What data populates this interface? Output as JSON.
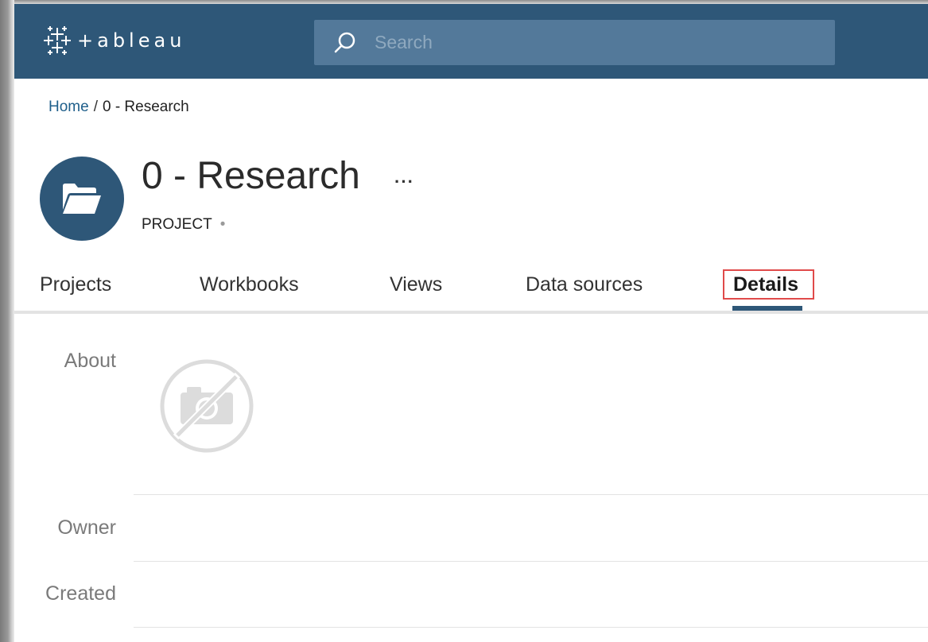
{
  "app": {
    "brand": "+ableau",
    "colors": {
      "primary": "#2e5778",
      "search_bg": "#53799a",
      "highlight": "#e04a4a"
    }
  },
  "search": {
    "placeholder": "Search",
    "icon": "search-icon"
  },
  "breadcrumb": {
    "home": "Home",
    "separator": "/",
    "current": "0 - Research"
  },
  "header": {
    "title": "0 - Research",
    "more": "···",
    "type_label": "PROJECT",
    "type_dot": "•",
    "icon": "folder-icon"
  },
  "tabs": [
    {
      "label": "Projects",
      "active": false
    },
    {
      "label": "Workbooks",
      "active": false
    },
    {
      "label": "Views",
      "active": false
    },
    {
      "label": "Data sources",
      "active": false
    },
    {
      "label": "Details",
      "active": true
    }
  ],
  "details": {
    "about_label": "About",
    "owner_label": "Owner",
    "created_label": "Created",
    "about_image": "no-photo-icon"
  }
}
